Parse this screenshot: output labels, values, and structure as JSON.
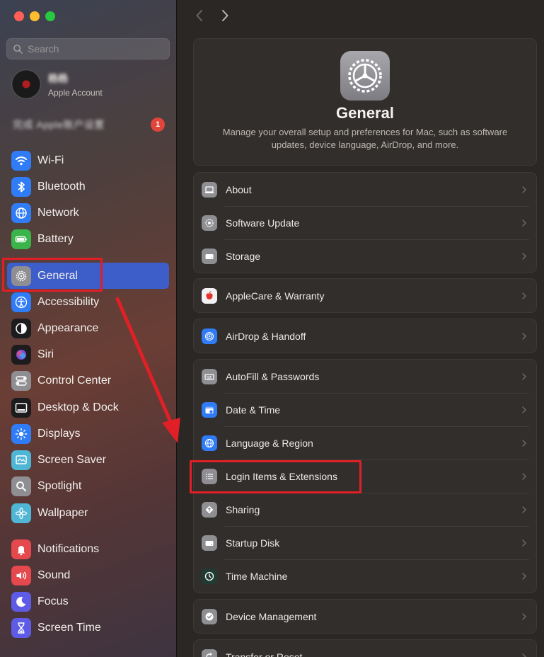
{
  "window": {
    "traffic_lights": [
      "close",
      "minimize",
      "zoom"
    ]
  },
  "search": {
    "placeholder": "Search",
    "value": ""
  },
  "account": {
    "name": "杨杨",
    "subtitle": "Apple Account"
  },
  "notice": {
    "text": "完成 Apple账户设置",
    "badge": "1"
  },
  "sidebar": {
    "items": [
      {
        "label": "Wi-Fi",
        "icon": "wifi-icon",
        "color": "#2f7cf6"
      },
      {
        "label": "Bluetooth",
        "icon": "bluetooth-icon",
        "color": "#2f7cf6"
      },
      {
        "label": "Network",
        "icon": "globe-icon",
        "color": "#2f7cf6"
      },
      {
        "label": "Battery",
        "icon": "battery-icon",
        "color": "#3bb54a"
      },
      {
        "label": "General",
        "icon": "gear-icon",
        "color": "#8e8e93",
        "selected": true
      },
      {
        "label": "Accessibility",
        "icon": "accessibility-icon",
        "color": "#2f7cf6"
      },
      {
        "label": "Appearance",
        "icon": "appearance-icon",
        "color": "#1c1c1e"
      },
      {
        "label": "Siri",
        "icon": "siri-icon",
        "color": "#1c1c1e"
      },
      {
        "label": "Control Center",
        "icon": "control-center-icon",
        "color": "#8e8e93"
      },
      {
        "label": "Desktop & Dock",
        "icon": "dock-icon",
        "color": "#1c1c1e"
      },
      {
        "label": "Displays",
        "icon": "sun-icon",
        "color": "#2f7cf6"
      },
      {
        "label": "Screen Saver",
        "icon": "screen-saver-icon",
        "color": "#4fb6d6"
      },
      {
        "label": "Spotlight",
        "icon": "magnifier-icon",
        "color": "#8e8e93"
      },
      {
        "label": "Wallpaper",
        "icon": "flower-icon",
        "color": "#4fb6d6"
      },
      {
        "label": "Notifications",
        "icon": "bell-icon",
        "color": "#e5484d"
      },
      {
        "label": "Sound",
        "icon": "speaker-icon",
        "color": "#e5484d"
      },
      {
        "label": "Focus",
        "icon": "moon-icon",
        "color": "#5e5ce6"
      },
      {
        "label": "Screen Time",
        "icon": "hourglass-icon",
        "color": "#5e5ce6"
      }
    ]
  },
  "main": {
    "title": "General",
    "description_line1": "Manage your overall setup and preferences for Mac, such as software",
    "description_line2": "updates, device language, AirDrop, and more.",
    "groups": [
      [
        {
          "label": "About",
          "icon": "laptop-icon"
        },
        {
          "label": "Software Update",
          "icon": "gear-badge-icon"
        },
        {
          "label": "Storage",
          "icon": "drive-icon"
        }
      ],
      [
        {
          "label": "AppleCare & Warranty",
          "icon": "apple-icon"
        }
      ],
      [
        {
          "label": "AirDrop & Handoff",
          "icon": "airdrop-icon"
        }
      ],
      [
        {
          "label": "AutoFill & Passwords",
          "icon": "keyboard-icon"
        },
        {
          "label": "Date & Time",
          "icon": "calendar-clock-icon"
        },
        {
          "label": "Language & Region",
          "icon": "globe-icon"
        },
        {
          "label": "Login Items & Extensions",
          "icon": "list-icon"
        },
        {
          "label": "Sharing",
          "icon": "sharing-icon"
        },
        {
          "label": "Startup Disk",
          "icon": "drive-icon"
        },
        {
          "label": "Time Machine",
          "icon": "time-machine-icon"
        }
      ],
      [
        {
          "label": "Device Management",
          "icon": "checkmark-gear-icon"
        }
      ],
      [
        {
          "label": "Transfer or Reset",
          "icon": "reset-icon"
        }
      ]
    ]
  },
  "annotations": {
    "highlight_color": "#e01f26",
    "highlighted_items": [
      "General",
      "Login Items & Extensions"
    ]
  }
}
